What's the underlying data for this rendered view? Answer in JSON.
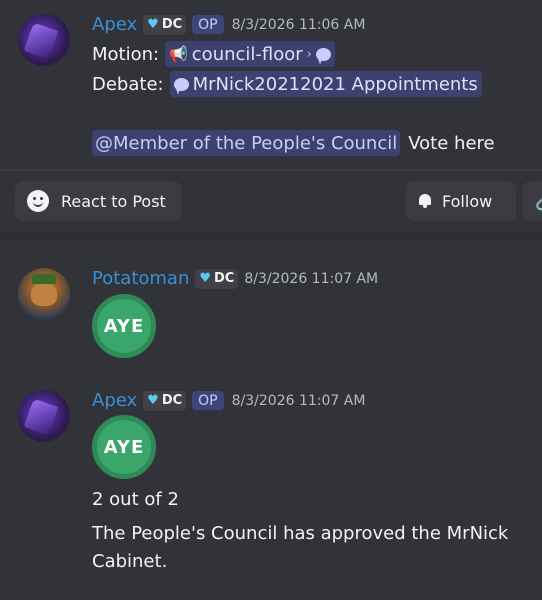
{
  "messages": [
    {
      "author": "Apex",
      "tag": "DC",
      "op_badge": "OP",
      "timestamp": "8/3/2026 11:06 AM",
      "motion_label": "Motion:",
      "motion_channel": "council-floor",
      "debate_label": "Debate:",
      "debate_thread": "MrNick20212021 Appointments",
      "mention": "@Member of the People's Council",
      "vote_text": "Vote here"
    },
    {
      "author": "Potatoman",
      "tag": "DC",
      "timestamp": "8/3/2026 11:07 AM",
      "sticker": "AYE"
    },
    {
      "author": "Apex",
      "tag": "DC",
      "op_badge": "OP",
      "timestamp": "8/3/2026 11:07 AM",
      "sticker": "AYE",
      "count_text": "2 out of 2",
      "result_text": "The People's Council has approved the MrNick Cabinet."
    }
  ],
  "actions": {
    "react_label": "React to Post",
    "follow_label": "Follow"
  },
  "colors": {
    "background": "#313338",
    "username": "#3a8fd8",
    "mention_bg": "rgba(88,101,242,0.3)",
    "aye_green": "#3aa66c"
  }
}
